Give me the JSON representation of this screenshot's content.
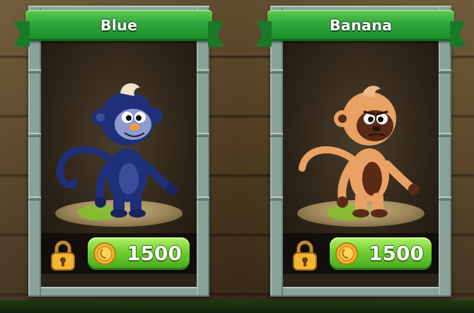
{
  "characters": [
    {
      "name": "Blue",
      "price": "1500",
      "locked": true,
      "fur_color": "#1f2f7a",
      "face_color": "#8e9bd0"
    },
    {
      "name": "Banana",
      "price": "1500",
      "locked": true,
      "fur_color": "#e9a264",
      "face_color": "#5a2a16"
    }
  ],
  "colors": {
    "banner_green": "#2fa63b",
    "button_green": "#6fcf2f",
    "stone_frame": "#8aa39a",
    "coin_gold": "#f2b632"
  },
  "icons": {
    "lock": "padlock-icon",
    "coin": "coin-icon"
  }
}
